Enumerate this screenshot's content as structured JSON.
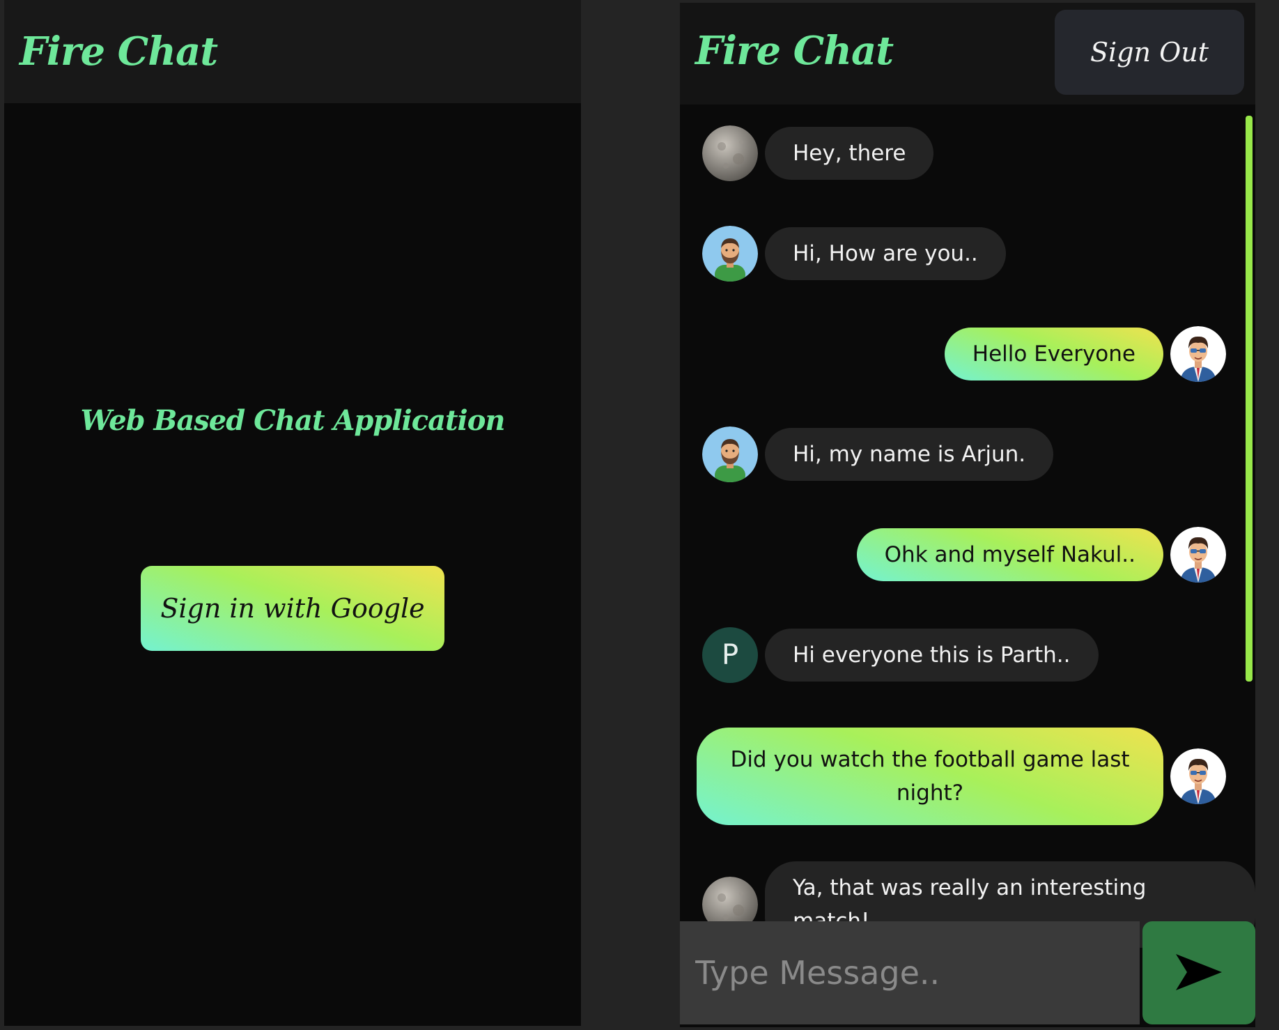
{
  "login_screen": {
    "app_title": "Fire Chat",
    "tagline": "Web Based Chat Application",
    "sign_in_label": "Sign in with Google"
  },
  "chat_screen": {
    "app_title": "Fire Chat",
    "sign_out_label": "Sign Out",
    "messages": [
      {
        "text": "Hey, there",
        "direction": "incoming",
        "avatar": "moon-avatar-icon"
      },
      {
        "text": "Hi, How are you..",
        "direction": "incoming",
        "avatar": "bearded-man-avatar-icon"
      },
      {
        "text": "Hello Everyone",
        "direction": "outgoing",
        "avatar": "businessman-avatar-icon"
      },
      {
        "text": "Hi, my name is Arjun.",
        "direction": "incoming",
        "avatar": "bearded-man-avatar-icon"
      },
      {
        "text": "Ohk and myself Nakul..",
        "direction": "outgoing",
        "avatar": "businessman-avatar-icon"
      },
      {
        "text": "Hi everyone this is Parth..",
        "direction": "incoming",
        "avatar_letter": "P"
      },
      {
        "text": "Did you watch the football game last night?",
        "direction": "outgoing",
        "avatar": "businessman-avatar-icon"
      },
      {
        "text": "Ya, that was really an interesting match!",
        "direction": "incoming",
        "avatar": "moon-avatar-icon"
      }
    ],
    "composer": {
      "placeholder": "Type Message..",
      "send_icon": "send-arrow-icon"
    }
  },
  "colors": {
    "brand_green": "#6ee89a",
    "gradient_yellow": "#efe24f",
    "gradient_green": "#a8f05a",
    "gradient_cyan": "#74f2d0",
    "send_button": "#2f7a42",
    "panel_bg": "#0a0a0a"
  }
}
